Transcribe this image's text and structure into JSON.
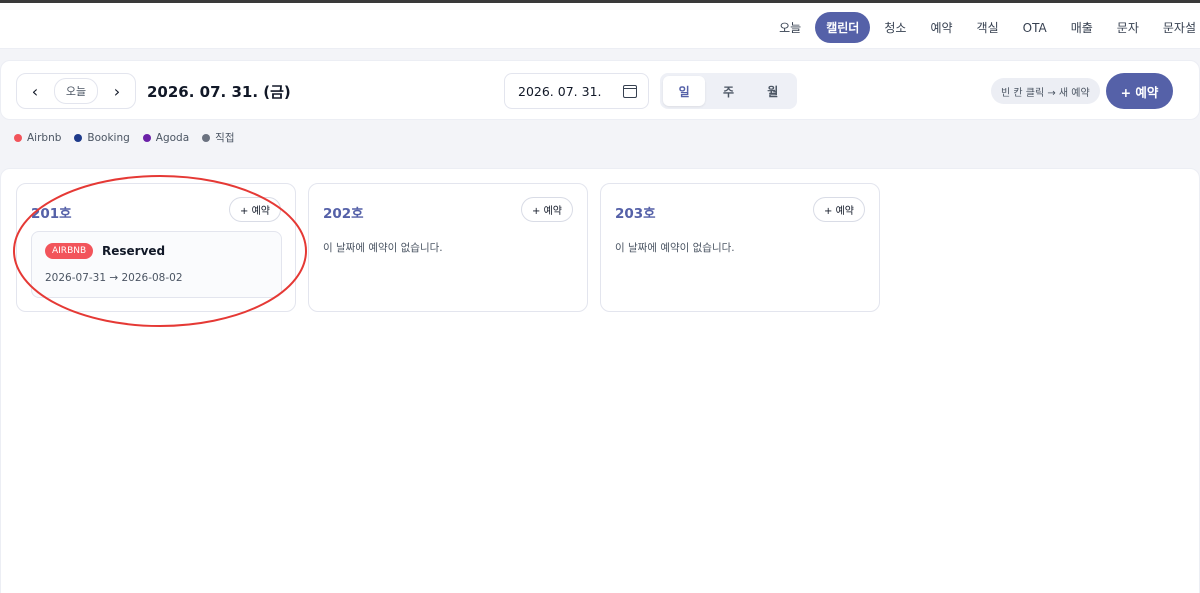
{
  "nav": {
    "items": [
      {
        "label": "오늘",
        "active": false
      },
      {
        "label": "캘린더",
        "active": true
      },
      {
        "label": "청소",
        "active": false
      },
      {
        "label": "예약",
        "active": false
      },
      {
        "label": "객실",
        "active": false
      },
      {
        "label": "OTA",
        "active": false
      },
      {
        "label": "매출",
        "active": false
      },
      {
        "label": "문자",
        "active": false
      },
      {
        "label": "문자설",
        "active": false
      }
    ]
  },
  "toolbar": {
    "prev": "‹",
    "today": "오늘",
    "next": "›",
    "current_date": "2026. 07. 31. (금)",
    "date_input": "2026. 07. 31.",
    "views": [
      "일",
      "주",
      "월"
    ],
    "active_view": "일",
    "hint": "빈 칸 클릭 → 새 예약",
    "new_booking": "+ 예약"
  },
  "legend": [
    {
      "label": "Airbnb",
      "color": "#f2545b"
    },
    {
      "label": "Booking",
      "color": "#1e3a8a"
    },
    {
      "label": "Agoda",
      "color": "#6b21a8"
    },
    {
      "label": "직접",
      "color": "#6b7280"
    }
  ],
  "rooms": [
    {
      "name": "201호",
      "add_label": "+ 예약",
      "reservation": {
        "channel": "AIRBNB",
        "status": "Reserved",
        "dates": "2026-07-31 → 2026-08-02"
      }
    },
    {
      "name": "202호",
      "add_label": "+ 예약",
      "empty": "이 날짜에 예약이 없습니다."
    },
    {
      "name": "203호",
      "add_label": "+ 예약",
      "empty": "이 날짜에 예약이 없습니다."
    }
  ],
  "colors": {
    "accent": "#5561a8",
    "airbnb": "#f2545b",
    "annotation": "#e53935"
  }
}
